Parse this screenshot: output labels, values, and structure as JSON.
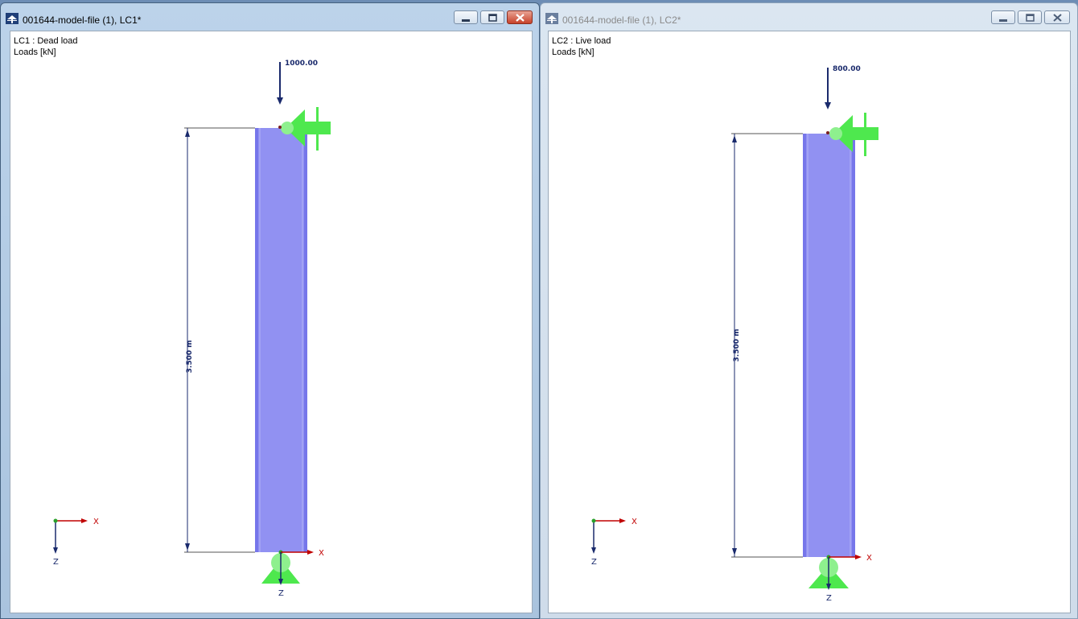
{
  "windows": [
    {
      "title": "001644-model-file (1), LC1*",
      "state": "active",
      "load_case": "LC1 : Dead load",
      "units": "Loads [kN]",
      "load_value": "1000.00",
      "length_label": "3.500 m",
      "axis_x": "X",
      "axis_z": "Z"
    },
    {
      "title": "001644-model-file (1), LC2*",
      "state": "inactive",
      "load_case": "LC2 : Live load",
      "units": "Loads [kN]",
      "load_value": "800.00",
      "length_label": "3.500 m",
      "axis_x": "X",
      "axis_z": "Z"
    }
  ],
  "icons": {
    "app": "rfem-app-icon",
    "minimize": "minimize-icon",
    "restore": "restore-icon",
    "close": "close-icon"
  },
  "colors": {
    "member_fill": "#9191f2",
    "member_edge": "#6f6fe8",
    "support": "#4ee84e",
    "load_arrow": "#1a2a6c",
    "axis_x": "#c00000",
    "axis_z": "#1a2a6c"
  }
}
